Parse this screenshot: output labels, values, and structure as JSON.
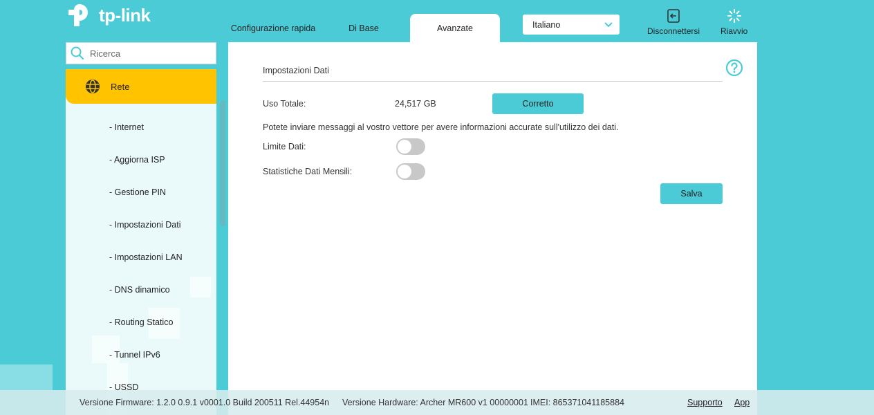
{
  "brand": {
    "name": "tp-link"
  },
  "tabs": [
    {
      "label": "Configurazione rapida"
    },
    {
      "label": "Di Base"
    },
    {
      "label": "Avanzate"
    }
  ],
  "language": {
    "value": "Italiano"
  },
  "top_buttons": {
    "logout": "Disconnettersi",
    "reboot": "Riavvio"
  },
  "search": {
    "placeholder": "Ricerca"
  },
  "sidebar": {
    "active_section": "Rete",
    "items": [
      {
        "label": "- Internet"
      },
      {
        "label": "- Aggiorna ISP"
      },
      {
        "label": "- Gestione PIN"
      },
      {
        "label": "- Impostazioni Dati"
      },
      {
        "label": "- Impostazioni LAN"
      },
      {
        "label": "- DNS dinamico"
      },
      {
        "label": "- Routing Statico"
      },
      {
        "label": "- Tunnel IPv6"
      },
      {
        "label": "- USSD"
      }
    ]
  },
  "main": {
    "section_title": "Impostazioni Dati",
    "usage_label": "Uso Totale:",
    "usage_value": "24,517 GB",
    "correct_button": "Corretto",
    "info_text": "Potete inviare messaggi al vostro vettore per avere informazioni accurate sull'utilizzo dei dati.",
    "data_limit_label": "Limite Dati:",
    "data_limit_enabled": false,
    "monthly_stats_label": "Statistiche Dati Mensili:",
    "monthly_stats_enabled": false,
    "save_button": "Salva"
  },
  "footer": {
    "firmware": "Versione Firmware: 1.2.0 0.9.1 v0001.0 Build 200511 Rel.44954n",
    "hardware": "Versione Hardware: Archer MR600 v1 00000001",
    "imei": "IMEI: 865371041185884",
    "support_link": "Supporto",
    "app_link": "App"
  },
  "colors": {
    "accent": "#4acbd6",
    "active": "#ffc300"
  }
}
